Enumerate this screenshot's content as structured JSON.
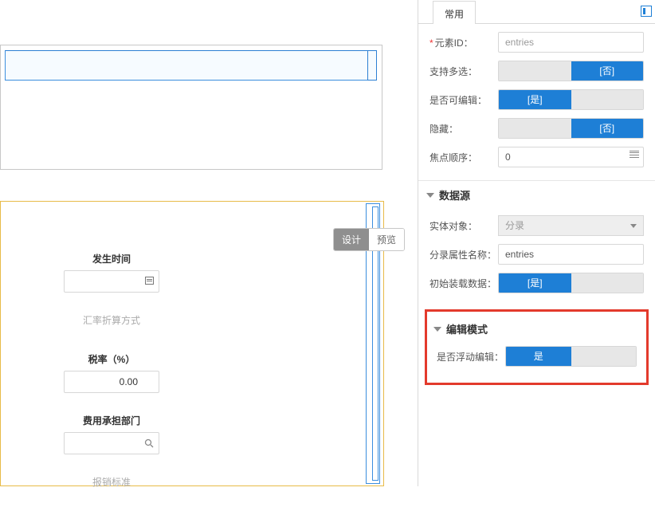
{
  "left": {
    "tabs": {
      "design": "设计",
      "preview": "预览"
    },
    "fields": {
      "happenTime": {
        "label": "发生时间",
        "value": ""
      },
      "exchangeMethod": {
        "label": "汇率折算方式",
        "value": ""
      },
      "taxRate": {
        "label": "税率（%）",
        "value": "0.00"
      },
      "costDept": {
        "label": "费用承担部门",
        "value": ""
      },
      "reimburseStd": {
        "label": "报销标准"
      }
    }
  },
  "right": {
    "tab": "常用",
    "common": {
      "elementId": {
        "label": "元素ID：",
        "value": "entries"
      },
      "multiSelect": {
        "label": "支持多选：",
        "value": "[否]"
      },
      "editable": {
        "label": "是否可编辑：",
        "value": "[是]"
      },
      "hidden": {
        "label": "隐藏：",
        "value": "[否]"
      },
      "focusOrder": {
        "label": "焦点顺序：",
        "value": "0"
      }
    },
    "datasource": {
      "title": "数据源",
      "entity": {
        "label": "实体对象：",
        "value": "分录"
      },
      "entryAttr": {
        "label": "分录属性名称：",
        "value": "entries"
      },
      "initialLoad": {
        "label": "初始装载数据：",
        "value": "[是]"
      }
    },
    "editMode": {
      "title": "编辑模式",
      "floatEdit": {
        "label": "是否浮动编辑：",
        "value": "是"
      }
    }
  }
}
